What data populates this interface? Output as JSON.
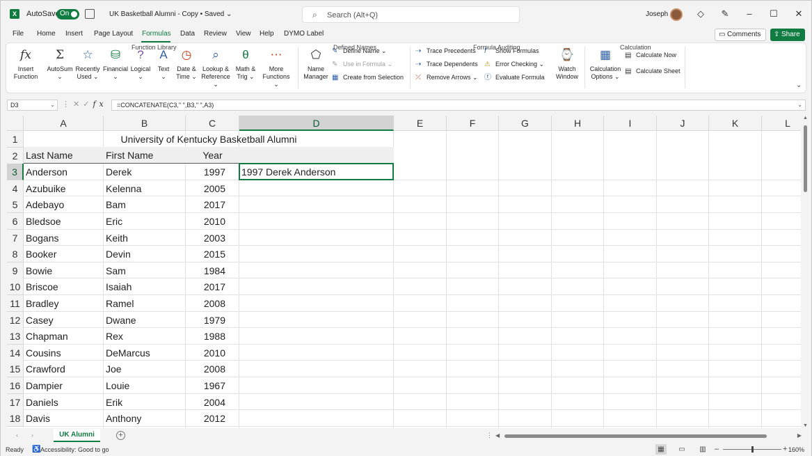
{
  "titlebar": {
    "app_logo": "X",
    "autosave_label": "AutoSave",
    "autosave_state": "On",
    "doc_title": "UK Basketball Alumni - Copy • Saved",
    "search_placeholder": "Search (Alt+Q)",
    "user_name": "Joseph"
  },
  "menu": {
    "tabs": [
      "File",
      "Home",
      "Insert",
      "Page Layout",
      "Formulas",
      "Data",
      "Review",
      "View",
      "Help",
      "DYMO Label"
    ],
    "active_tab": "Formulas",
    "comments_label": "Comments",
    "share_label": "Share"
  },
  "ribbon": {
    "function_library": {
      "label": "Function Library",
      "buttons": [
        {
          "l1": "Insert",
          "l2": "Function"
        },
        {
          "l1": "AutoSum",
          "l2": "⌄"
        },
        {
          "l1": "Recently",
          "l2": "Used ⌄"
        },
        {
          "l1": "Financial",
          "l2": "⌄"
        },
        {
          "l1": "Logical",
          "l2": "⌄"
        },
        {
          "l1": "Text",
          "l2": "⌄"
        },
        {
          "l1": "Date &",
          "l2": "Time ⌄"
        },
        {
          "l1": "Lookup &",
          "l2": "Reference ⌄"
        },
        {
          "l1": "Math &",
          "l2": "Trig ⌄"
        },
        {
          "l1": "More",
          "l2": "Functions ⌄"
        }
      ]
    },
    "defined_names": {
      "label": "Defined Names",
      "name_manager_l1": "Name",
      "name_manager_l2": "Manager",
      "define_name": "Define Name",
      "use_in_formula": "Use in Formula",
      "create_from_selection": "Create from Selection"
    },
    "formula_auditing": {
      "label": "Formula Auditing",
      "trace_precedents": "Trace Precedents",
      "trace_dependents": "Trace Dependents",
      "remove_arrows": "Remove Arrows",
      "show_formulas": "Show Formulas",
      "error_checking": "Error Checking",
      "evaluate_formula": "Evaluate Formula",
      "watch_window_l1": "Watch",
      "watch_window_l2": "Window"
    },
    "calculation": {
      "label": "Calculation",
      "options_l1": "Calculation",
      "options_l2": "Options ⌄",
      "calculate_now": "Calculate Now",
      "calculate_sheet": "Calculate Sheet"
    }
  },
  "formula_bar": {
    "name_box": "D3",
    "fx_symbol": "fx",
    "formula": "=CONCATENATE(C3,\" \",B3,\" \",A3)"
  },
  "sheet": {
    "columns": [
      "A",
      "B",
      "C",
      "D",
      "E",
      "F",
      "G",
      "H",
      "I",
      "J",
      "K",
      "L"
    ],
    "selected_column": "D",
    "selected_row": 3,
    "title": "University of Kentucky Basketball Alumni",
    "headers": [
      "Last Name",
      "First Name",
      "Year"
    ],
    "rows": [
      {
        "n": 3,
        "last": "Anderson",
        "first": "Derek",
        "year": "1997",
        "d": "1997 Derek Anderson"
      },
      {
        "n": 4,
        "last": "Azubuike",
        "first": "Kelenna",
        "year": "2005",
        "d": ""
      },
      {
        "n": 5,
        "last": "Adebayo",
        "first": "Bam",
        "year": "2017",
        "d": ""
      },
      {
        "n": 6,
        "last": "Bledsoe",
        "first": "Eric",
        "year": "2010",
        "d": ""
      },
      {
        "n": 7,
        "last": "Bogans",
        "first": "Keith",
        "year": "2003",
        "d": ""
      },
      {
        "n": 8,
        "last": "Booker",
        "first": "Devin",
        "year": "2015",
        "d": ""
      },
      {
        "n": 9,
        "last": "Bowie",
        "first": "Sam",
        "year": "1984",
        "d": ""
      },
      {
        "n": 10,
        "last": "Briscoe",
        "first": "Isaiah",
        "year": "2017",
        "d": ""
      },
      {
        "n": 11,
        "last": "Bradley",
        "first": "Ramel",
        "year": "2008",
        "d": ""
      },
      {
        "n": 12,
        "last": "Casey",
        "first": "Dwane",
        "year": "1979",
        "d": ""
      },
      {
        "n": 13,
        "last": "Chapman",
        "first": "Rex",
        "year": "1988",
        "d": ""
      },
      {
        "n": 14,
        "last": "Cousins",
        "first": "DeMarcus",
        "year": "2010",
        "d": ""
      },
      {
        "n": 15,
        "last": "Crawford",
        "first": "Joe",
        "year": "2008",
        "d": ""
      },
      {
        "n": 16,
        "last": "Dampier",
        "first": "Louie",
        "year": "1967",
        "d": ""
      },
      {
        "n": 17,
        "last": "Daniels",
        "first": "Erik",
        "year": "2004",
        "d": ""
      },
      {
        "n": 18,
        "last": "Davis",
        "first": "Anthony",
        "year": "2012",
        "d": ""
      }
    ]
  },
  "sheet_tabs": {
    "active": "UK Alumni"
  },
  "status": {
    "ready": "Ready",
    "accessibility": "Accessibility: Good to go",
    "zoom": "160%"
  },
  "colors": {
    "accent": "#107c41"
  }
}
